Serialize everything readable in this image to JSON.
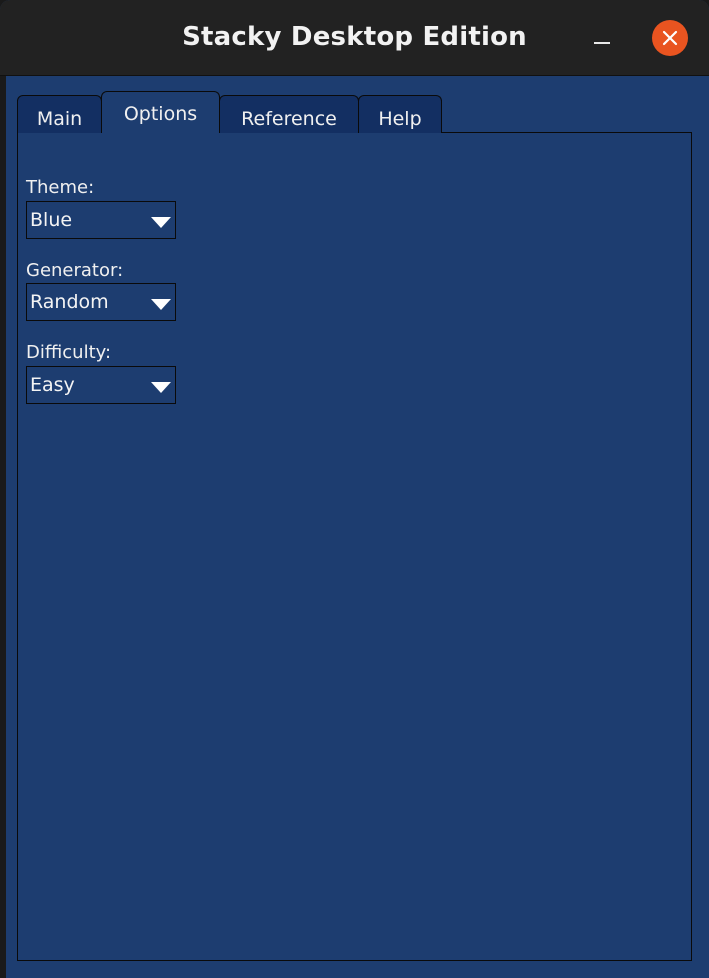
{
  "window": {
    "title": "Stacky Desktop Edition",
    "controls": {
      "minimize": "minimize-icon",
      "close": "close-icon"
    },
    "close_color": "#e95420"
  },
  "tabs": [
    {
      "label": "Main",
      "active": false
    },
    {
      "label": "Options",
      "active": true
    },
    {
      "label": "Reference",
      "active": false
    },
    {
      "label": "Help",
      "active": false
    }
  ],
  "options": {
    "theme": {
      "label": "Theme:",
      "value": "Blue"
    },
    "generator": {
      "label": "Generator:",
      "value": "Random"
    },
    "difficulty": {
      "label": "Difficulty:",
      "value": "Easy"
    }
  },
  "colors": {
    "background": "#1d3d70",
    "tab_inactive": "#132f62",
    "titlebar": "#222222"
  }
}
